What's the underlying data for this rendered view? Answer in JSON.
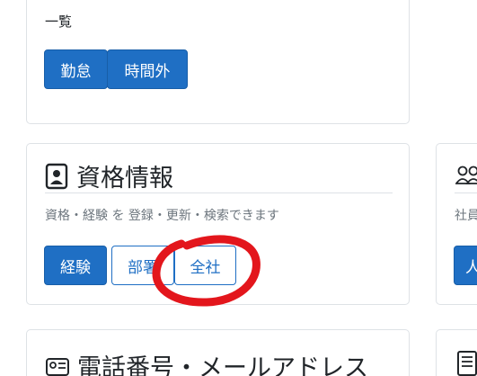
{
  "top_card": {
    "subtitle": "一覧",
    "buttons": [
      "勤怠",
      "時間外"
    ]
  },
  "qualification_card": {
    "title": "資格情報",
    "icon": "id-badge-icon",
    "description": "資格・経験 を 登録・更新・検索できます",
    "buttons": {
      "experience": "経験",
      "department": "部署",
      "company": "全社"
    }
  },
  "right_card_1": {
    "icon": "people-icon",
    "text_fragment": "社員",
    "button_fragment": "人"
  },
  "contact_card": {
    "title": "電話番号・メールアドレス",
    "icon": "contact-card-icon"
  },
  "right_card_2": {
    "icon": "document-icon"
  },
  "annotation": {
    "color": "#e3161c",
    "target": "全社"
  }
}
